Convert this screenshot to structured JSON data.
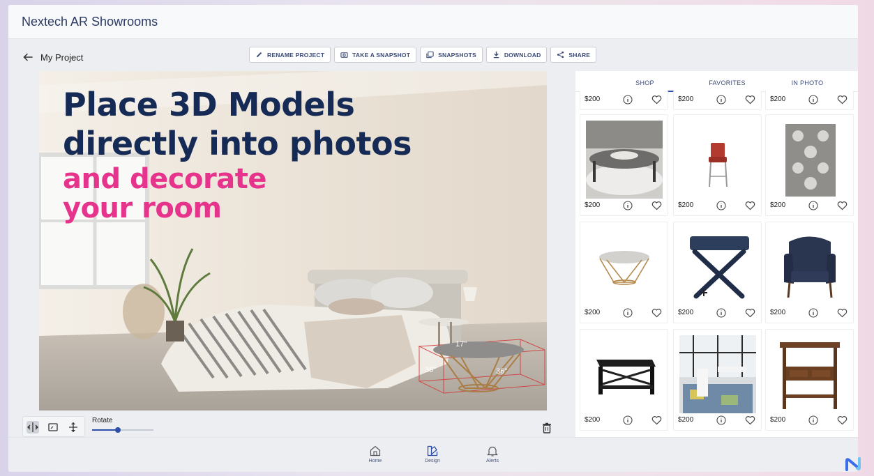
{
  "app": {
    "title": "Nextech AR Showrooms"
  },
  "project": {
    "name": "My Project",
    "back_icon": "arrow-left-icon"
  },
  "toolbar": {
    "rename": "RENAME PROJECT",
    "snapshot": "TAKE A SNAPSHOT",
    "snapshots": "SNAPSHOTS",
    "download": "DOWNLOAD",
    "share": "SHARE"
  },
  "canvas": {
    "line1": "Place 3D Models",
    "line2": "directly into photos",
    "line3": "and decorate",
    "line4": "your room",
    "dims": {
      "top": "17\"",
      "left": "36\"",
      "right": "36\""
    },
    "colors": {
      "dark": "#152a55",
      "pink": "#e6338c"
    }
  },
  "controls": {
    "rotate_label": "Rotate",
    "rotate_value": 0.42
  },
  "panel": {
    "tabs": [
      "SHOP",
      "FAVORITES",
      "IN PHOTO"
    ],
    "active_tab": 0,
    "products": [
      {
        "price": "$200",
        "thumb": "coffee-table-round"
      },
      {
        "price": "$200",
        "thumb": "bar-stool-red"
      },
      {
        "price": "$200",
        "thumb": "area-rug-grey"
      },
      {
        "price": "$200",
        "thumb": "side-table-wire"
      },
      {
        "price": "$200",
        "thumb": "ottoman-x-base"
      },
      {
        "price": "$200",
        "thumb": "armchair-navy"
      },
      {
        "price": "$200",
        "thumb": "coffee-table-black"
      },
      {
        "price": "$200",
        "thumb": "dining-room-scene"
      },
      {
        "price": "$200",
        "thumb": "console-table-wood"
      }
    ],
    "top_row": [
      "$200",
      "$200",
      "$200"
    ]
  },
  "nav": {
    "home": "Home",
    "design": "Design",
    "alerts": "Alerts"
  }
}
